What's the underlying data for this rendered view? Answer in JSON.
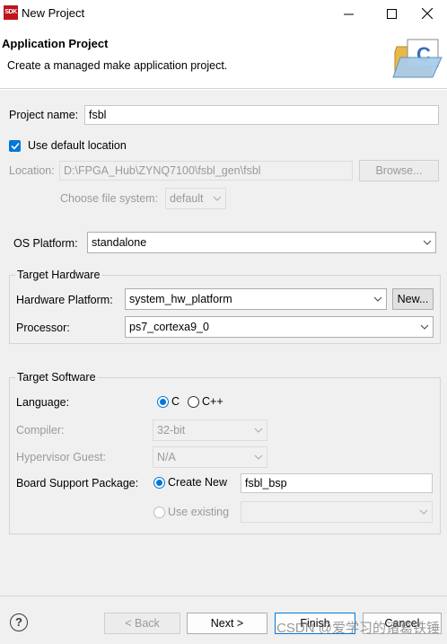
{
  "window": {
    "title": "New Project",
    "icon_text": "SDK"
  },
  "header": {
    "title": "Application Project",
    "subtitle": "Create a managed make application project."
  },
  "project": {
    "name_label": "Project name:",
    "name_value": "fsbl"
  },
  "location": {
    "use_default_label": "Use default location",
    "location_label": "Location:",
    "location_value": "D:\\FPGA_Hub\\ZYNQ7100\\fsbl_gen\\fsbl",
    "browse_label": "Browse...",
    "filesystem_label": "Choose file system:",
    "filesystem_value": "default"
  },
  "os": {
    "label": "OS Platform:",
    "value": "standalone"
  },
  "hardware": {
    "group_title": "Target Hardware",
    "platform_label": "Hardware Platform:",
    "platform_value": "system_hw_platform",
    "new_label": "New...",
    "processor_label": "Processor:",
    "processor_value": "ps7_cortexa9_0"
  },
  "software": {
    "group_title": "Target Software",
    "language_label": "Language:",
    "lang_c": "C",
    "lang_cpp": "C++",
    "compiler_label": "Compiler:",
    "compiler_value": "32-bit",
    "hypervisor_label": "Hypervisor Guest:",
    "hypervisor_value": "N/A",
    "bsp_label": "Board Support Package:",
    "create_new_label": "Create New",
    "bsp_name": "fsbl_bsp",
    "use_existing_label": "Use existing"
  },
  "footer": {
    "help": "?",
    "back_label": "< Back",
    "next_label": "Next >",
    "finish_label": "Finish",
    "cancel_label": "Cancel",
    "watermark": "CSDN @爱学习的诸葛铁锤"
  }
}
